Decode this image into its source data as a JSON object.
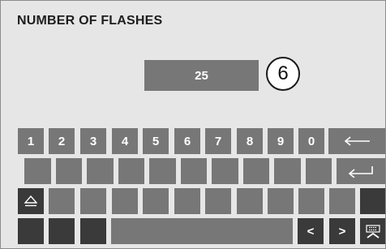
{
  "header": {
    "title": "NUMBER OF FLASHES"
  },
  "display": {
    "value": "25",
    "callout": "6"
  },
  "keyboard": {
    "digits": [
      "1",
      "2",
      "3",
      "4",
      "5",
      "6",
      "7",
      "8",
      "9",
      "0"
    ],
    "nav_left": "<",
    "nav_right": ">",
    "icons": {
      "backspace": "backspace-arrow-icon",
      "enter": "enter-return-icon",
      "eject": "eject-shift-icon",
      "keyboard": "keyboard-icon"
    }
  }
}
